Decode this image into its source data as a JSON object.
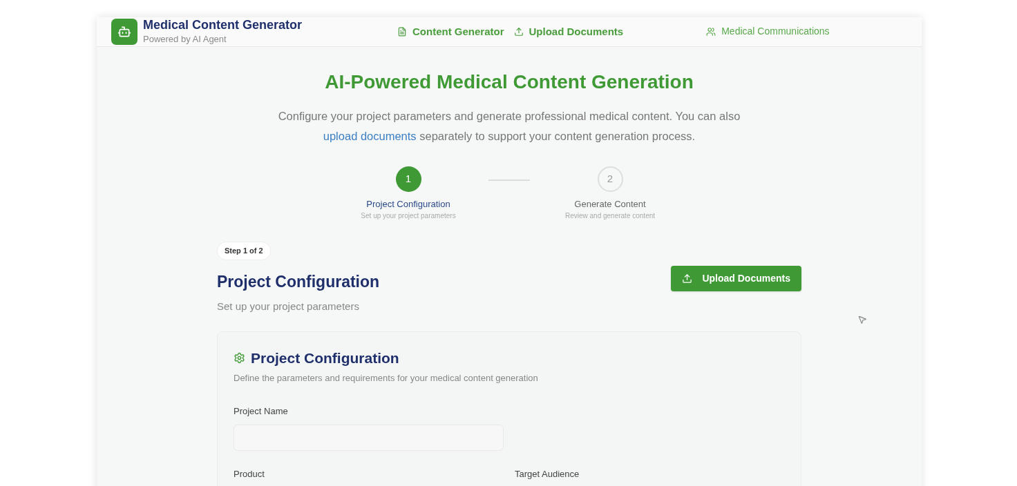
{
  "header": {
    "title": "Medical Content Generator",
    "subtitle": "Powered by AI Agent",
    "nav": [
      {
        "label": "Content Generator",
        "emphasis": true
      },
      {
        "label": "Upload Documents",
        "emphasis": true
      },
      {
        "label": "Medical Communications",
        "emphasis": false
      }
    ]
  },
  "hero": {
    "title": "AI-Powered Medical Content Generation",
    "intro_before": "Configure your project parameters and generate professional medical content. You can also",
    "intro_link": "upload documents",
    "intro_after": "separately to support your content generation process."
  },
  "steps": [
    {
      "number": "1",
      "title": "Project Configuration",
      "subtitle": "Set up your project parameters",
      "selected": true
    },
    {
      "number": "2",
      "title": "Generate Content",
      "subtitle": "Review and generate content",
      "selected": false
    }
  ],
  "section": {
    "badge": "Step 1 of 2",
    "title": "Project Configuration",
    "subtitle": "Set up your project parameters",
    "button": "Upload Documents"
  },
  "card": {
    "title": "Project Configuration",
    "subtitle": "Define the parameters and requirements for your medical content generation",
    "rows": [
      [
        {
          "label": "Project Name"
        }
      ],
      [
        {
          "label": "Product"
        },
        {
          "label": "Target Audience"
        }
      ]
    ]
  }
}
